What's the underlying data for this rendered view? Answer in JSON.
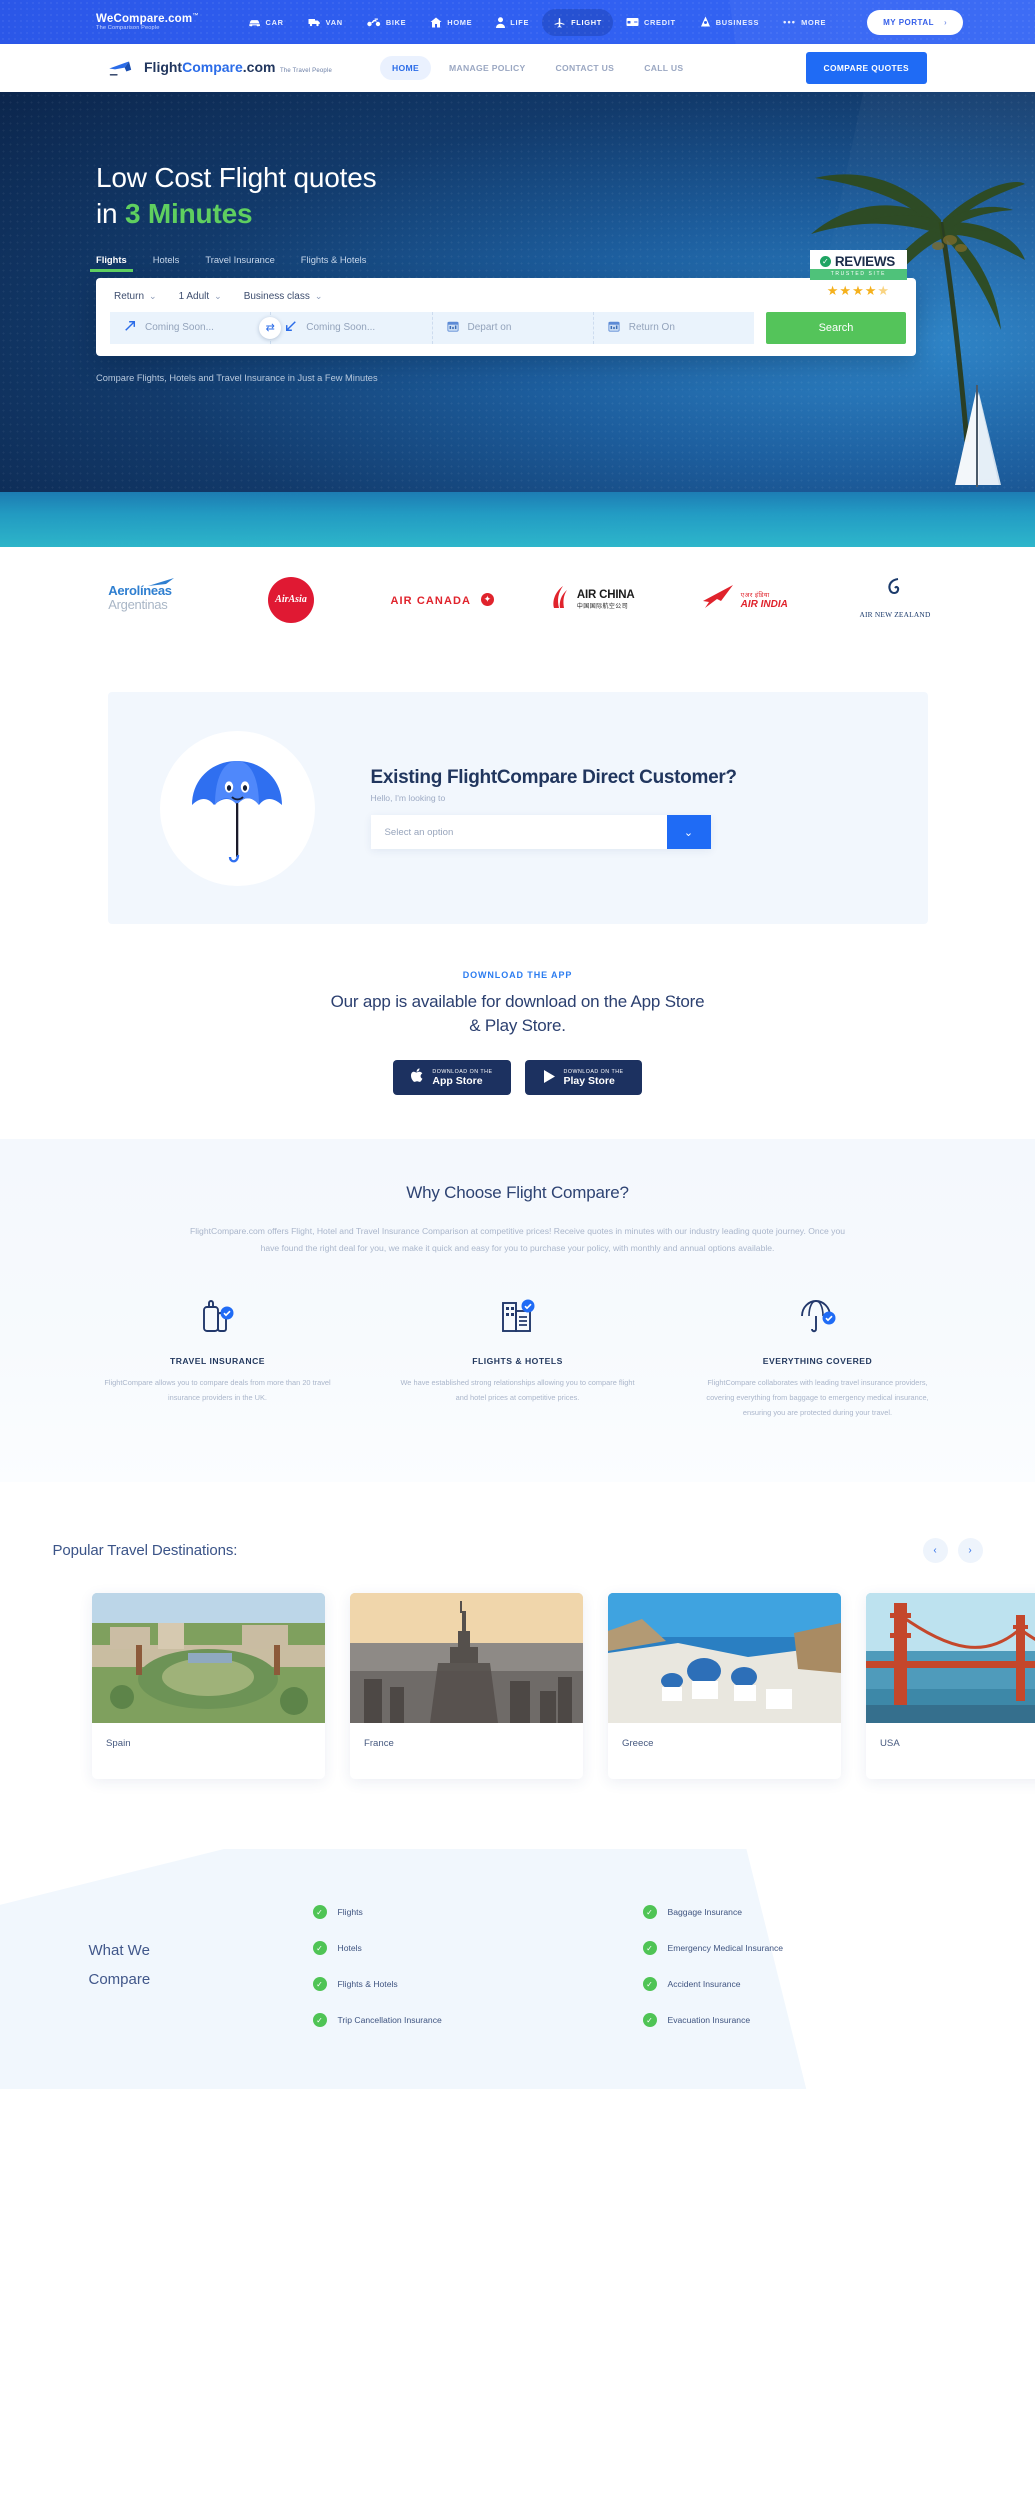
{
  "topbar": {
    "brand_name": "WeCompare.com",
    "brand_tm": "™",
    "brand_tagline": "The Comparison People",
    "items": [
      {
        "label": "CAR",
        "icon": "car-icon",
        "active": false
      },
      {
        "label": "VAN",
        "icon": "van-icon",
        "active": false
      },
      {
        "label": "BIKE",
        "icon": "motorbike-icon",
        "active": false
      },
      {
        "label": "HOME",
        "icon": "home-icon",
        "active": false
      },
      {
        "label": "LIFE",
        "icon": "person-icon",
        "active": false
      },
      {
        "label": "FLIGHT",
        "icon": "plane-icon",
        "active": true
      },
      {
        "label": "CREDIT",
        "icon": "credit-card-icon",
        "active": false
      },
      {
        "label": "BUSINESS",
        "icon": "business-icon",
        "active": false
      },
      {
        "label": "MORE",
        "icon": "ellipsis-icon",
        "active": false
      }
    ],
    "portal_label": "MY PORTAL",
    "portal_chevron": "›"
  },
  "header": {
    "logo_main_pre": "Flight",
    "logo_main_mid": "Compare",
    "logo_main_post": ".com",
    "logo_tagline": "The Travel People",
    "nav": [
      {
        "label": "HOME",
        "active": true
      },
      {
        "label": "MANAGE POLICY",
        "active": false
      },
      {
        "label": "CONTACT US",
        "active": false
      },
      {
        "label": "CALL US",
        "active": false
      }
    ],
    "cta_label": "COMPARE QUOTES"
  },
  "hero": {
    "title_line1": "Low Cost Flight quotes",
    "title_line2_prefix": "in ",
    "title_line2_highlight": "3 Minutes",
    "tabs": [
      {
        "label": "Flights",
        "active": true
      },
      {
        "label": "Hotels",
        "active": false
      },
      {
        "label": "Travel Insurance",
        "active": false
      },
      {
        "label": "Flights & Hotels",
        "active": false
      }
    ],
    "options": [
      {
        "label": "Return",
        "chevron": "⌄"
      },
      {
        "label": "1 Adult",
        "chevron": "⌄"
      },
      {
        "label": "Business class",
        "chevron": "⌄"
      }
    ],
    "fields": {
      "origin_placeholder": "Coming Soon...",
      "destination_placeholder": "Coming Soon...",
      "depart_placeholder": "Depart on",
      "return_placeholder": "Return On"
    },
    "search_label": "Search",
    "note": "Compare Flights, Hotels and Travel Insurance in Just a Few Minutes",
    "reviews": {
      "word": "REVIEWS",
      "strip": "TRUSTED SITE",
      "stars": "★★★★",
      "half_star": "★",
      "tick": "✓"
    },
    "accent_green": "#5fcf5f",
    "search_button_color": "#54c45a"
  },
  "airlines": [
    {
      "name": "Aerolineas Argentinas",
      "line1": "Aerolíneas",
      "line2": "Argentinas"
    },
    {
      "name": "AirAsia",
      "line1": "AirAsia"
    },
    {
      "name": "Air Canada",
      "line1": "AIR CANADA"
    },
    {
      "name": "Air China",
      "line1": "AIR CHINA",
      "line2": "中国国际航空公司"
    },
    {
      "name": "Air India",
      "line1": "AIR INDIA",
      "line2": "एअर इंडिया"
    },
    {
      "name": "Air New Zealand",
      "line1": "AIR NEW ZEALAND"
    }
  ],
  "customer": {
    "heading": "Existing FlightCompare Direct Customer?",
    "subheading": "Hello, I'm looking to",
    "select_value": "Select an option",
    "select_chevron": "⌄",
    "illustration": "umbrella-mascot-icon"
  },
  "download": {
    "eyebrow": "DOWNLOAD THE APP",
    "headline": "Our app is available for download on the App Store & Play Store.",
    "buttons": [
      {
        "small": "DOWNLOAD ON THE",
        "big": "App Store",
        "icon": "apple-icon"
      },
      {
        "small": "DOWNLOAD ON THE",
        "big": "Play Store",
        "icon": "play-icon"
      }
    ]
  },
  "why": {
    "heading": "Why Choose Flight Compare?",
    "lead": "FlightCompare.com offers Flight, Hotel and Travel Insurance Comparison at competitive prices! Receive quotes in minutes with our industry leading quote journey. Once you have found the right deal for you, we make it quick and easy for you to purchase your policy, with monthly and annual options available.",
    "features": [
      {
        "icon": "luggage-check-icon",
        "title": "TRAVEL INSURANCE",
        "text": "FlightCompare allows you to compare deals from more than 20 travel insurance providers in the UK."
      },
      {
        "icon": "hotel-check-icon",
        "title": "FLIGHTS & HOTELS",
        "text": "We have established strong relationships allowing you to compare flight and hotel prices at competitive prices."
      },
      {
        "icon": "umbrella-check-icon",
        "title": "EVERYTHING COVERED",
        "text": "FlightCompare collaborates with leading travel insurance providers, covering everything from baggage to emergency medical insurance, ensuring you are protected during your travel."
      }
    ]
  },
  "destinations": {
    "heading": "Popular Travel Destinations:",
    "prev_arrow": "‹",
    "next_arrow": "›",
    "cards": [
      {
        "label": "Spain",
        "image": "spain-plaza-photo"
      },
      {
        "label": "France",
        "image": "paris-eiffel-tower-photo"
      },
      {
        "label": "Greece",
        "image": "santorini-photo"
      },
      {
        "label": "USA",
        "image": "golden-gate-bridge-photo"
      }
    ]
  },
  "compare": {
    "title_line1": "What We",
    "title_line2": "Compare",
    "tick": "✓",
    "column_left": [
      "Flights",
      "Hotels",
      "Flights & Hotels",
      "Trip Cancellation Insurance"
    ],
    "column_right": [
      "Baggage Insurance",
      "Emergency Medical Insurance",
      "Accident Insurance",
      "Evacuation Insurance"
    ],
    "tick_color": "#4fc455"
  }
}
